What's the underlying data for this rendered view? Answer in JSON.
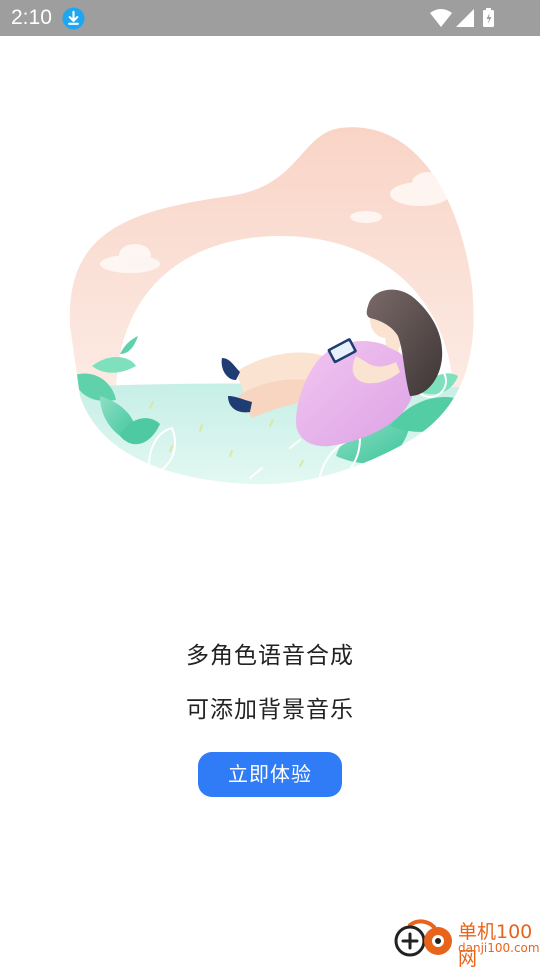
{
  "status_bar": {
    "time": "2:10",
    "icons": [
      "download-icon",
      "wifi-icon",
      "signal-icon",
      "battery-icon"
    ]
  },
  "illustration": {
    "subject": "woman-reading-phone-icon"
  },
  "headline": {
    "line1": "多角色语音合成",
    "line2": "可添加背景音乐"
  },
  "cta": {
    "label": "立即体验"
  },
  "watermark": {
    "name": "单机100网",
    "url": "danji100.com"
  },
  "colors": {
    "status_bar_bg": "#9e9e9e",
    "cta_bg": "#2f7cf6",
    "text": "#222222",
    "watermark": "#e8641b"
  }
}
